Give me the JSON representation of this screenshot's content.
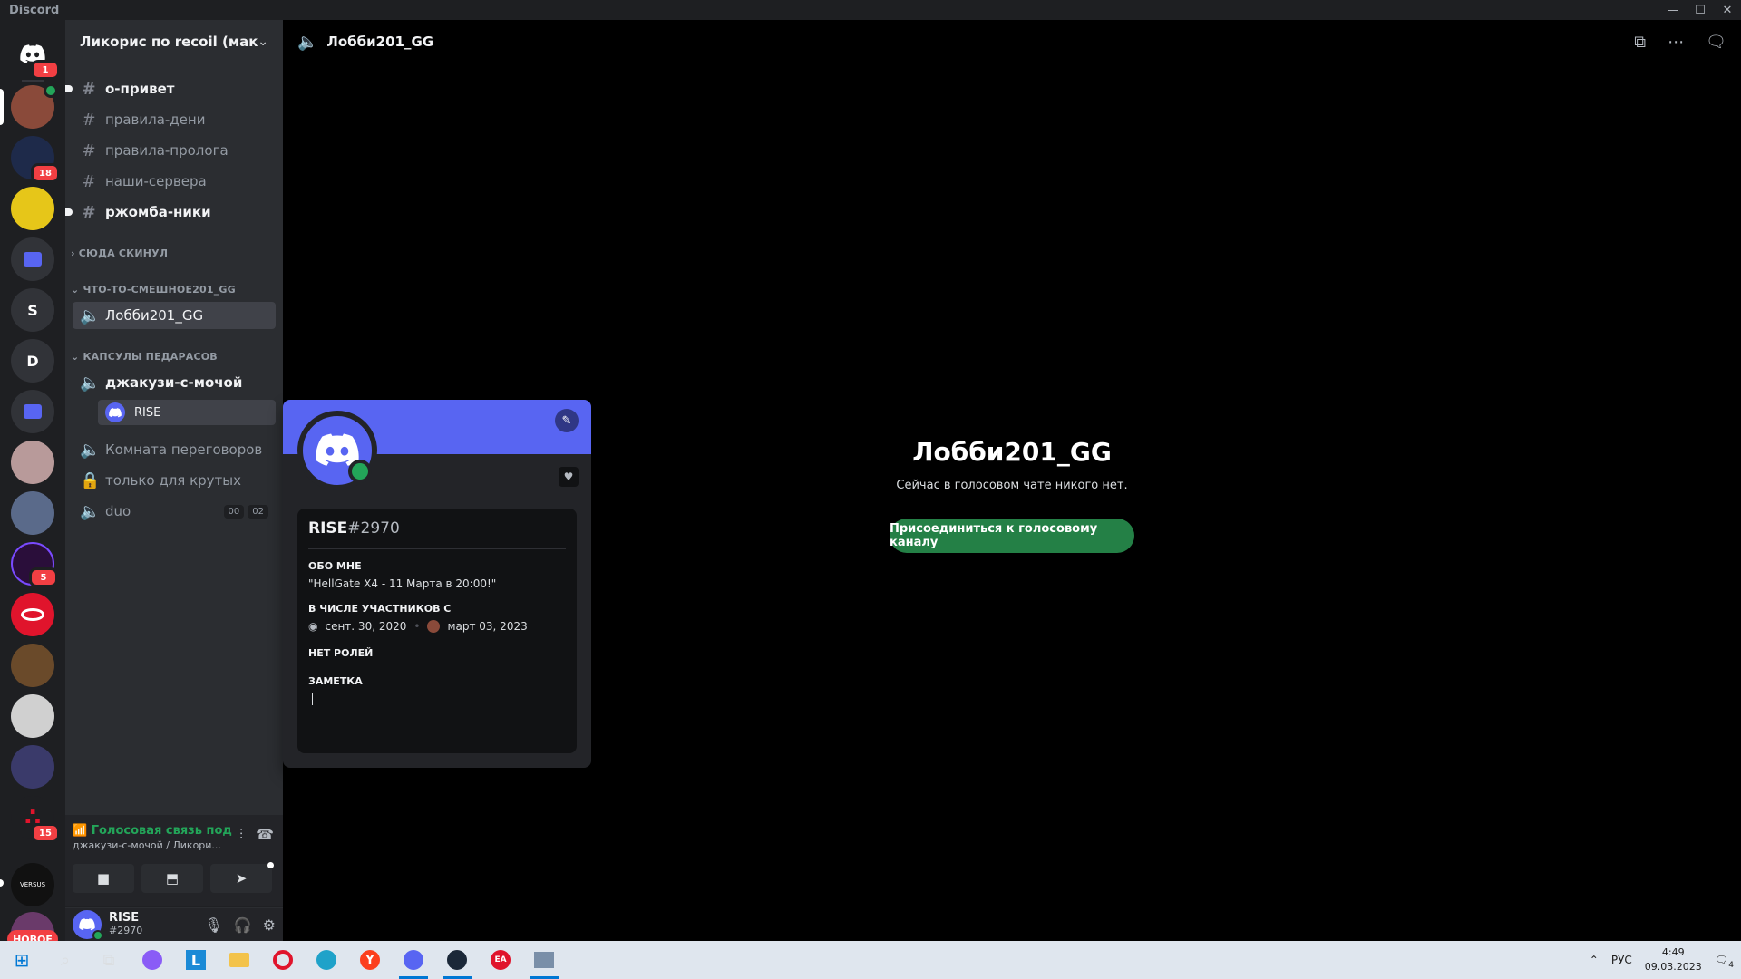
{
  "window": {
    "title": "Discord",
    "controls": [
      "—",
      "☐",
      "✕"
    ]
  },
  "guilds": {
    "items": [
      {
        "name": "home",
        "label": "",
        "color": "#5865f2",
        "badge": "1"
      },
      {
        "name": "guild-1",
        "label": "",
        "color": "#8a4a3a",
        "badge": ""
      },
      {
        "name": "guild-2",
        "label": "",
        "color": "#1e2a4a",
        "badge": "18"
      },
      {
        "name": "guild-3",
        "label": "",
        "color": "#e6c619",
        "badge": ""
      },
      {
        "name": "folder-1",
        "label": "",
        "color": "#5865f2",
        "badge": ""
      },
      {
        "name": "guild-s",
        "label": "S",
        "color": "#313338",
        "badge": ""
      },
      {
        "name": "guild-d",
        "label": "D",
        "color": "#313338",
        "badge": ""
      },
      {
        "name": "folder-2",
        "label": "",
        "color": "#5865f2",
        "badge": ""
      },
      {
        "name": "guild-4",
        "label": "",
        "color": "#b89a9a",
        "badge": ""
      },
      {
        "name": "guild-5",
        "label": "",
        "color": "#5a6a8a",
        "badge": ""
      },
      {
        "name": "guild-6",
        "label": "",
        "color": "#2a0e3a",
        "badge": "5"
      },
      {
        "name": "guild-7",
        "label": "",
        "color": "#e0142c",
        "badge": ""
      },
      {
        "name": "guild-8",
        "label": "",
        "color": "#6a4a2a",
        "badge": ""
      },
      {
        "name": "guild-9",
        "label": "",
        "color": "#d0d0d0",
        "badge": ""
      },
      {
        "name": "guild-10",
        "label": "",
        "color": "#3a3a6a",
        "badge": ""
      },
      {
        "name": "guild-11",
        "label": "",
        "color": "#1e1f22",
        "badge": "15"
      },
      {
        "name": "guild-12",
        "label": "VERSUS",
        "color": "#111",
        "badge": ""
      },
      {
        "name": "guild-13",
        "label": "",
        "color": "#6a3a6a",
        "badge": ""
      }
    ],
    "new_badge": "НОВОЕ"
  },
  "server": {
    "name": "Ликорис по recoil (макр...",
    "channels_top": [
      {
        "name": "о-привет",
        "icon": "#",
        "unread": true
      },
      {
        "name": "правила-дени",
        "icon": "#",
        "unread": false
      },
      {
        "name": "правила-пролога",
        "icon": "#",
        "unread": false
      },
      {
        "name": "наши-сервера",
        "icon": "#",
        "unread": false
      },
      {
        "name": "ржомба-ники",
        "icon": "#",
        "unread": true
      }
    ],
    "cat_1": "СЮДА СКИНУЛ",
    "cat_2": "ЧТО-ТО-СМЕШНОЕ201_GG",
    "lobby": "Лобби201_GG",
    "cat_3": "КАПСУЛЫ ПЕДАРАСОВ",
    "jacuzzi": "джакузи-с-мочой",
    "voice_user": "RISE",
    "room": "Комната переговоров",
    "locked": "только для крутых",
    "duo": "duo",
    "duo_count_a": "00",
    "duo_count_b": "02"
  },
  "voice_panel": {
    "status": "Голосовая связь под",
    "sub": "джакузи-с-мочой / Ликори..."
  },
  "user": {
    "name": "RISE",
    "tag": "#2970"
  },
  "main": {
    "channel_title": "Лобби201_GG",
    "empty_title": "Лобби201_GG",
    "empty_sub": "Сейчас в голосовом чате никого нет.",
    "join_label": "Присоединиться к голосовому каналу"
  },
  "popout": {
    "username": "RISE",
    "discriminator": "#2970",
    "about_label": "ОБО МНЕ",
    "about_text": " \"HellGate X4 - 11 Марта в 20:00!\"",
    "member_since_label": "В ЧИСЛЕ УЧАСТНИКОВ С",
    "discord_since": "сент. 30, 2020",
    "server_since": "март 03, 2023",
    "roles_label": "НЕТ РОЛЕЙ",
    "note_label": "ЗАМЕТКА"
  },
  "taskbar": {
    "lang": "РУС",
    "time": "4:49",
    "date": "09.03.2023",
    "notif_count": "4"
  }
}
